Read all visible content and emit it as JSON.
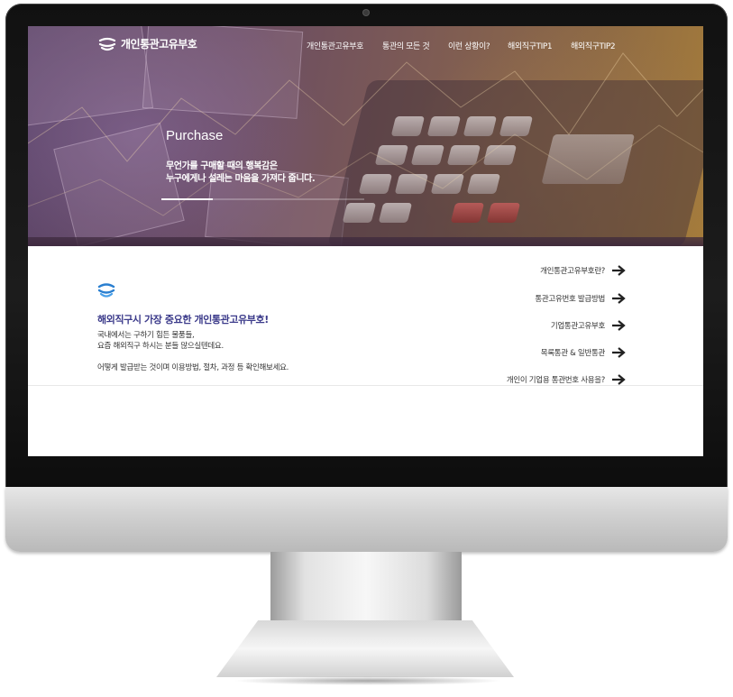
{
  "site": {
    "logo_text": "개인통관고유부호",
    "nav": [
      "개인통관고유부호",
      "통관의 모든 것",
      "이런 상황이?",
      "해외직구TIP1",
      "해외직구TIP2"
    ]
  },
  "hero": {
    "title": "Purchase",
    "subtitle_line1": "무언가를 구매할 때의 행복감은",
    "subtitle_line2": "누구에게나 설레는 마음을 가져다 줍니다."
  },
  "intro": {
    "heading": "해외직구시 가장 중요한 개인통관고유부호!",
    "line1": "국내에서는 구하기 힘든 물품들,",
    "line2": "요즘 해외직구 하시는 분들 많으실텐데요.",
    "line3": "어떻게 발급받는 것이며 이용방법, 절차, 과정 등 확인해보세요."
  },
  "links": [
    "개인통관고유부호란?",
    "통관고유번호 발급방법",
    "기업통관고유부호",
    "목록통관 & 일반통관",
    "개인이 기업용 통관번호 사용을?"
  ],
  "colors": {
    "heading": "#3b3a8a",
    "logo_blue": "#2a7fd0"
  },
  "icons": {
    "logo": "layered-sphere-icon",
    "link_arrow": "arrow-right-icon"
  }
}
